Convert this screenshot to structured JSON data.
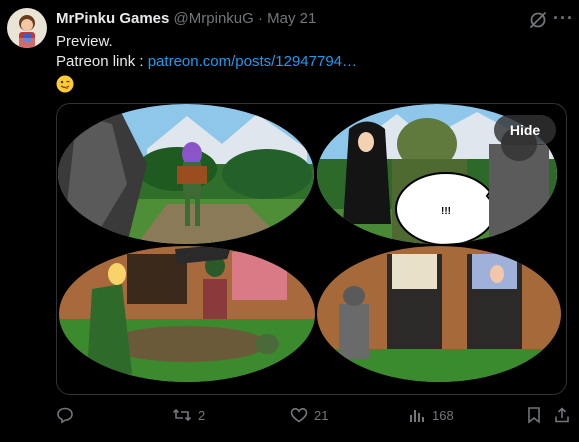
{
  "post": {
    "author_name": "MrPinku Games",
    "author_handle": "@MrpinkuG",
    "separator": "·",
    "date": "May 21",
    "line1": "Preview.",
    "line2_prefix": "Patreon link :",
    "link_text": "patreon.com/posts/12947794…",
    "emoji_icon": "winking-tongue-face-icon"
  },
  "media": {
    "hide_label": "Hide",
    "speech_text": "!!!"
  },
  "actions": {
    "reply_count": "",
    "repost_count": "2",
    "like_count": "21",
    "views_count": "168"
  },
  "colors": {
    "link": "#1d9bf0",
    "muted": "#71767b",
    "text": "#e7e9ea",
    "border": "#2f3336"
  }
}
